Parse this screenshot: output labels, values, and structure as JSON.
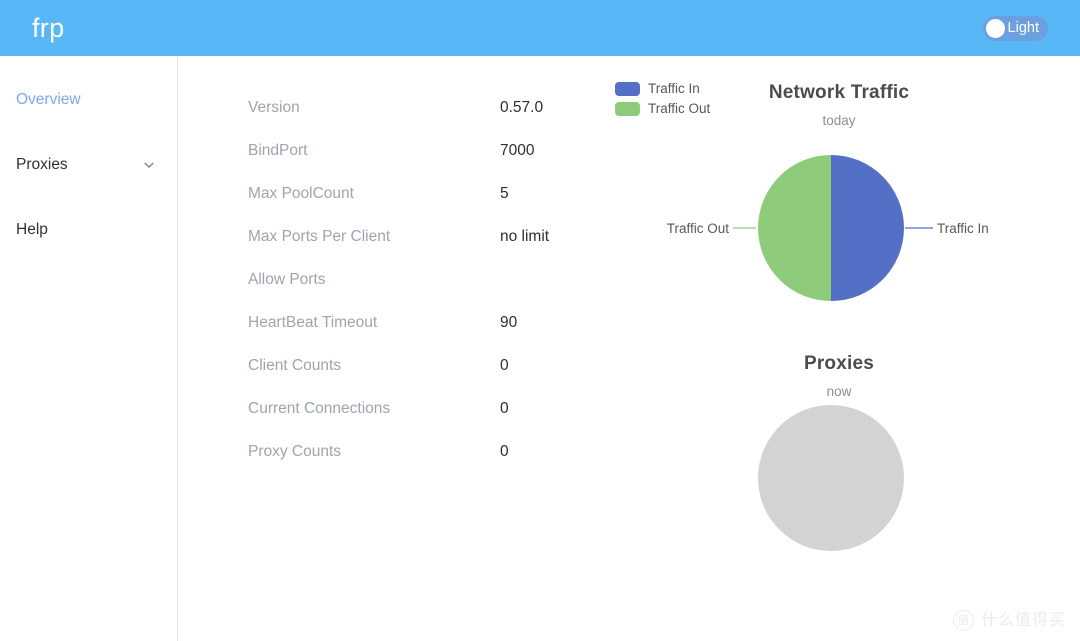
{
  "header": {
    "brand": "frp",
    "theme_toggle": {
      "label": "Light",
      "knob_icon": "circle-knob",
      "track_color": "#6c9fe0"
    },
    "background_color": "#58b7f6"
  },
  "sidebar": {
    "items": [
      {
        "label": "Overview",
        "active": true,
        "has_chevron": false
      },
      {
        "label": "Proxies",
        "active": false,
        "has_chevron": true,
        "chevron_icon": "chevron-down-icon"
      },
      {
        "label": "Help",
        "active": false,
        "has_chevron": false
      }
    ],
    "active_color": "#7fa9e6"
  },
  "server_info": {
    "rows": [
      {
        "label": "Version",
        "value": "0.57.0"
      },
      {
        "label": "BindPort",
        "value": "7000"
      },
      {
        "label": "Max PoolCount",
        "value": "5"
      },
      {
        "label": "Max Ports Per Client",
        "value": "no limit"
      },
      {
        "label": "Allow Ports",
        "value": ""
      },
      {
        "label": "HeartBeat Timeout",
        "value": "90"
      },
      {
        "label": "Client Counts",
        "value": "0"
      },
      {
        "label": "Current Connections",
        "value": "0"
      },
      {
        "label": "Proxy Counts",
        "value": "0"
      }
    ]
  },
  "chart_data": [
    {
      "type": "pie",
      "title": "Network Traffic",
      "subtitle": "today",
      "legend_position": "top-left",
      "legend": [
        "Traffic In",
        "Traffic Out"
      ],
      "labels": [
        "Traffic In",
        "Traffic Out"
      ],
      "values": [
        50,
        50
      ],
      "colors": [
        "#5470c6",
        "#8ecc7b"
      ],
      "label_left": "Traffic Out",
      "label_right": "Traffic In",
      "empty": false
    },
    {
      "type": "pie",
      "title": "Proxies",
      "subtitle": "now",
      "legend": [],
      "labels": [],
      "values": [],
      "colors": [
        "#d3d3d3"
      ],
      "empty": true,
      "empty_color": "#d3d3d3"
    }
  ],
  "watermark": {
    "badge": "值",
    "text": "什么值得买"
  }
}
